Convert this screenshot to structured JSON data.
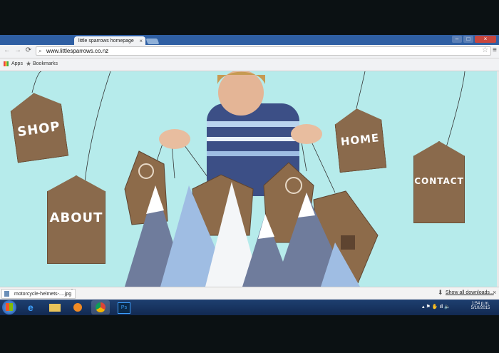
{
  "browser": {
    "tab_title": "little sparrows homepage",
    "tab_close": "×",
    "url": "www.littlesparrows.co.nz",
    "bookmarks": {
      "apps_label": "Apps",
      "bookmarks_label": "Bookmarks"
    },
    "window_buttons": [
      "–",
      "□",
      "×"
    ]
  },
  "site": {
    "nav": {
      "shop": "SHOP",
      "about": "ABOUT",
      "home": "HOME",
      "contact": "CONTACT"
    }
  },
  "downloads": {
    "file_name": "motorcycle-helmets-....jpg",
    "show_all": "Show all downloads...",
    "close": "×"
  },
  "taskbar": {
    "time": "1:54 p.m.",
    "date": "5/10/2015",
    "apps": [
      "internet-explorer",
      "file-explorer",
      "media-player",
      "chrome",
      "photoshop"
    ]
  },
  "colors": {
    "page_background": "#b6ebeb",
    "tag_brown": "#8a6a4c",
    "titlebar_blue": "#2f5fa3"
  }
}
